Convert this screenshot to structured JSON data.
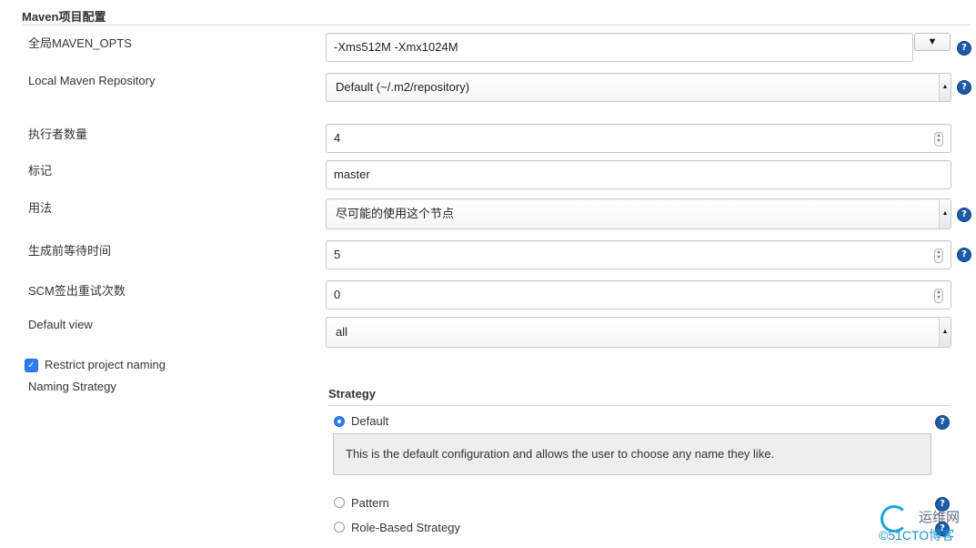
{
  "section": {
    "title": "Maven项目配置"
  },
  "fields": {
    "maven_opts": {
      "label": "全局MAVEN_OPTS",
      "value": "-Xms512M -Xmx1024M",
      "dropdown_glyph": "▼"
    },
    "local_repo": {
      "label": "Local Maven Repository",
      "value": "Default (~/.m2/repository)"
    },
    "executors": {
      "label": "执行者数量",
      "value": "4"
    },
    "labels": {
      "label": "标记",
      "value": "master"
    },
    "usage": {
      "label": "用法",
      "value": "尽可能的使用这个节点"
    },
    "quiet_period": {
      "label": "生成前等待时间",
      "value": "5"
    },
    "scm_retry": {
      "label": "SCM签出重试次数",
      "value": "0"
    },
    "default_view": {
      "label": "Default view",
      "value": "all"
    }
  },
  "restrict": {
    "label": "Restrict project naming",
    "checked": true,
    "check_glyph": "✓"
  },
  "naming": {
    "label": "Naming Strategy",
    "strategy_title": "Strategy",
    "options": [
      {
        "label": "Default",
        "selected": true
      },
      {
        "label": "Pattern",
        "selected": false
      },
      {
        "label": "Role-Based Strategy",
        "selected": false
      }
    ],
    "default_description": "This is the default configuration and allows the user to choose any name they like."
  },
  "help_glyph": "?",
  "watermark": {
    "line1": "运维网",
    "line2": "©51CTO博客"
  },
  "colors": {
    "accent": "#2f7cf6",
    "help": "#1d5aa8",
    "desc_bg": "#eeeeee"
  }
}
